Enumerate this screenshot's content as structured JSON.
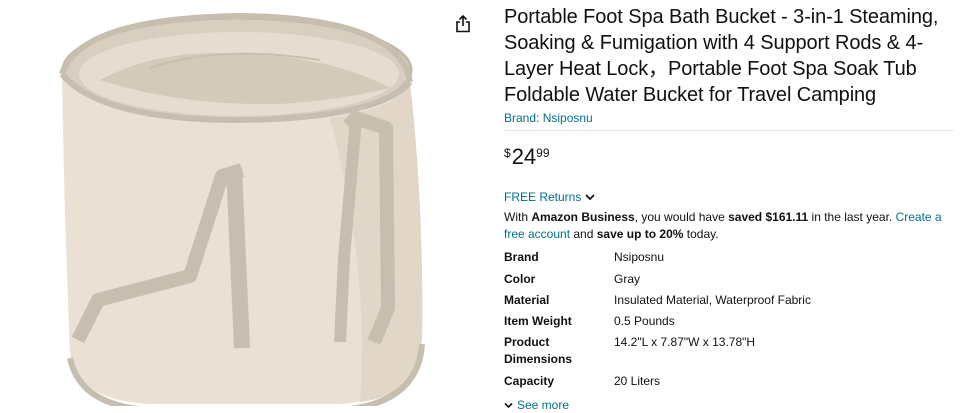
{
  "product": {
    "title": "Portable Foot Spa Bath Bucket - 3-in-1 Steaming, Soaking & Fumigation with 4 Support Rods & 4-Layer Heat Lock，Portable Foot Spa Soak Tub Foldable Water Bucket for Travel Camping",
    "brand_link": "Brand: Nsiposnu",
    "image_icon": "product-image",
    "share_icon": "share-icon"
  },
  "price": {
    "symbol": "$",
    "whole": "24",
    "fraction": "99"
  },
  "returns": {
    "label": "FREE Returns",
    "icon": "chevron-down-icon"
  },
  "business": {
    "prefix": "With ",
    "program": "Amazon Business",
    "middle": ", you would have ",
    "saved": "saved $161.11",
    "after": " in the last year. ",
    "link": "Create a free account",
    "and": " and ",
    "save_up": "save up to 20%",
    "end": " today."
  },
  "specs": [
    {
      "label": "Brand",
      "value": "Nsiposnu"
    },
    {
      "label": "Color",
      "value": "Gray"
    },
    {
      "label": "Material",
      "value": "Insulated Material, Waterproof Fabric"
    },
    {
      "label": "Item Weight",
      "value": "0.5 Pounds"
    },
    {
      "label": "Product Dimensions",
      "value": "14.2\"L x 7.87\"W x 13.78\"H"
    },
    {
      "label": "Capacity",
      "value": "20 Liters"
    }
  ],
  "see_more": {
    "label": "See more",
    "icon": "chevron-down-icon"
  },
  "colors": {
    "link": "#007185",
    "text": "#0f1111",
    "bucket": "#eae0d3",
    "strap": "#c6bfb0"
  }
}
